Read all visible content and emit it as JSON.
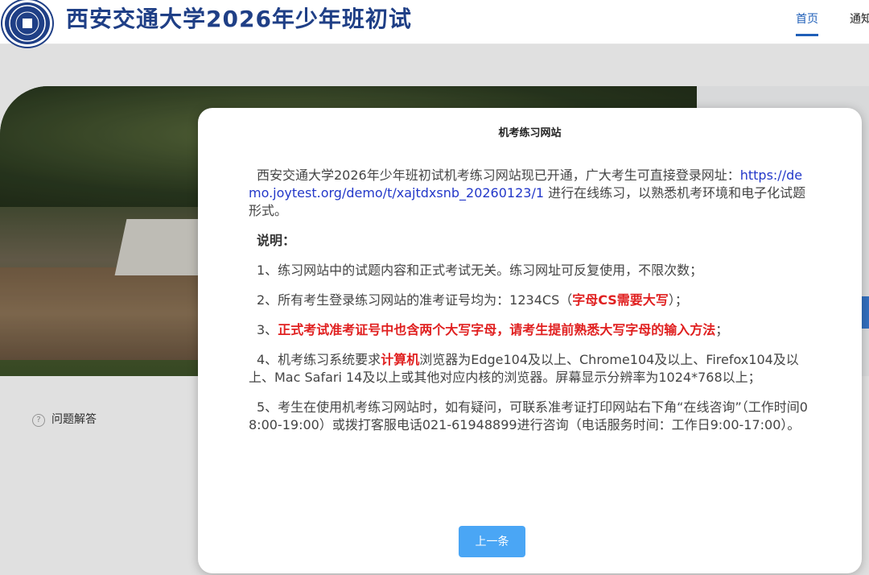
{
  "header": {
    "title": "西安交通大学2026年少年班初试",
    "nav": [
      {
        "label": "首页"
      },
      {
        "label": "通知"
      }
    ]
  },
  "sidebar": {
    "faq_label": "问题解答"
  },
  "modal": {
    "title": "机考练习网站",
    "intro_text": "西安交通大学2026年少年班初试机考练习网站现已开通，广大考生可直接登录网址：",
    "intro_link": "https://demo.joytest.org/demo/t/xajtdxsnb_20260123/1",
    "intro_tail": " 进行在线练习，以熟悉机考环境和电子化试题形式。",
    "notes_heading": "说明：",
    "item1": "1、练习网站中的试题内容和正式考试无关。练习网址可反复使用，不限次数；",
    "item2_text": "2、所有考生登录练习网站的准考证号均为：1234CS（",
    "item2_red": "字母CS需要大写",
    "item2_tail": "）；",
    "item3_prefix": "3、",
    "item3_red": "正式考试准考证号中也含两个大写字母，请考生提前熟悉大写字母的输入方法",
    "item3_tail": "；",
    "item4_text": "4、机考练习系统要求",
    "item4_red": "计算机",
    "item4_tail": "浏览器为Edge104及以上、Chrome104及以上、Firefox104及以上、Mac Safari 14及以上或其他对应内核的浏览器。屏幕显示分辨率为1024*768以上；",
    "item5": "5、考生在使用机考练习网站时，如有疑问，可联系准考证打印网站右下角“在线咨询”（工作时间08:00-19:00）或拨打客服电话021-61948899进行咨询（电话服务时间：工作日9:00-17:00）。",
    "prev_button_label": "上一条"
  },
  "colors": {
    "brand": "#1f3f86",
    "link": "#2338c9",
    "warning": "#e02020",
    "button": "#4aa6f5"
  }
}
